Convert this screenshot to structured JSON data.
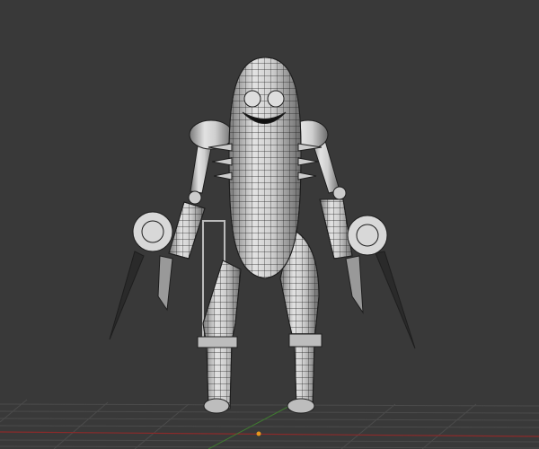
{
  "viewport": {
    "background_color": "#393939",
    "grid_color": "#4a4a4a",
    "x_axis_color": "#8c2a2a",
    "y_axis_color": "#3f7a30",
    "origin_color": "#e8961e",
    "mesh_color": "#c8c8c8",
    "wire_color": "#1e1e1e"
  }
}
